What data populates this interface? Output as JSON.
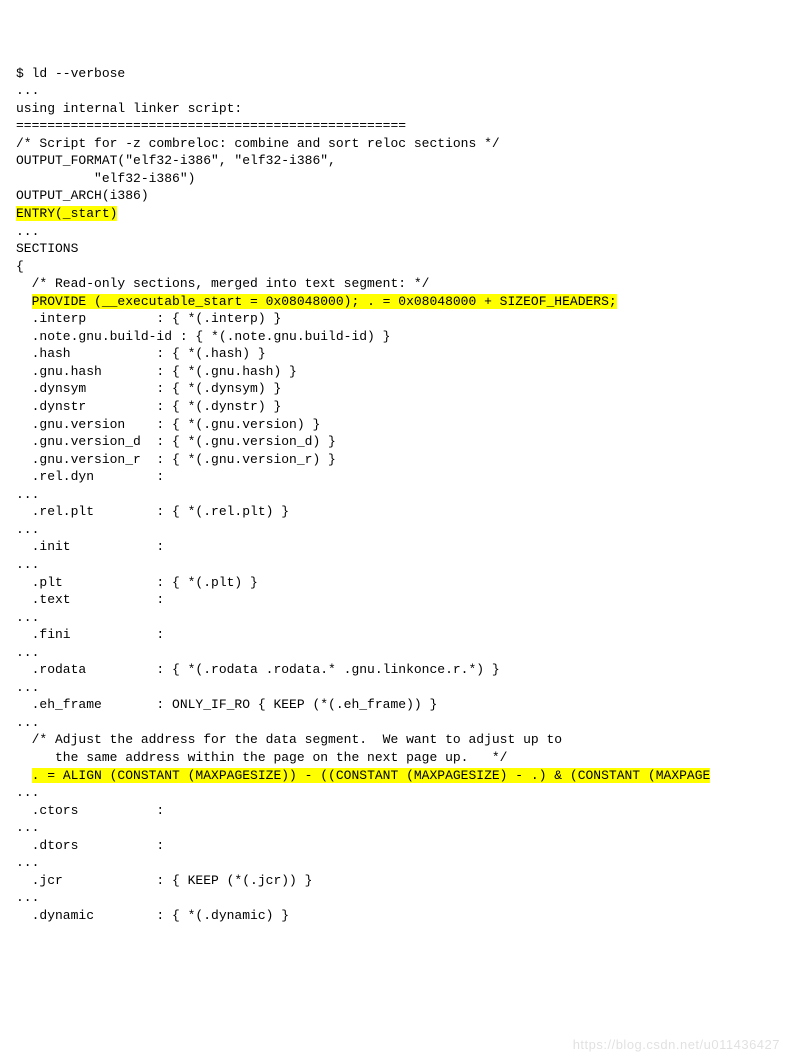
{
  "lines": {
    "l01": "$ ld --verbose",
    "l02": "...",
    "l03": "using internal linker script:",
    "l04": "==================================================",
    "l05": "/* Script for -z combreloc: combine and sort reloc sections */",
    "l06": "OUTPUT_FORMAT(\"elf32-i386\", \"elf32-i386\",",
    "l07": "          \"elf32-i386\")",
    "l08": "OUTPUT_ARCH(i386)",
    "l09": "ENTRY(_start)",
    "l10": "...",
    "l11": "SECTIONS",
    "l12": "{",
    "l13": "  /* Read-only sections, merged into text segment: */",
    "l14": "  PROVIDE (__executable_start = 0x08048000); . = 0x08048000 + SIZEOF_HEADERS;",
    "l15": "  .interp         : { *(.interp) }",
    "l16": "  .note.gnu.build-id : { *(.note.gnu.build-id) }",
    "l17": "  .hash           : { *(.hash) }",
    "l18": "  .gnu.hash       : { *(.gnu.hash) }",
    "l19": "  .dynsym         : { *(.dynsym) }",
    "l20": "  .dynstr         : { *(.dynstr) }",
    "l21": "  .gnu.version    : { *(.gnu.version) }",
    "l22": "  .gnu.version_d  : { *(.gnu.version_d) }",
    "l23": "  .gnu.version_r  : { *(.gnu.version_r) }",
    "l24": "  .rel.dyn        :",
    "l25": "...",
    "l26": "  .rel.plt        : { *(.rel.plt) }",
    "l27": "...",
    "l28": "  .init           :",
    "l29": "...",
    "l30": "  .plt            : { *(.plt) }",
    "l31": "  .text           :",
    "l32": "...",
    "l33": "  .fini           :",
    "l34": "...",
    "l35": "  .rodata         : { *(.rodata .rodata.* .gnu.linkonce.r.*) }",
    "l36": "...",
    "l37": "  .eh_frame       : ONLY_IF_RO { KEEP (*(.eh_frame)) }",
    "l38": "...",
    "l39": "  /* Adjust the address for the data segment.  We want to adjust up to",
    "l40": "     the same address within the page on the next page up.   */",
    "l41": "  . = ALIGN (CONSTANT (MAXPAGESIZE)) - ((CONSTANT (MAXPAGESIZE) - .) & (CONSTANT (MAXPAGE",
    "l42": "...",
    "l43": "  .ctors          :",
    "l44": "...",
    "l45": "  .dtors          :",
    "l46": "...",
    "l47": "  .jcr            : { KEEP (*(.jcr)) }",
    "l48": "...",
    "l49": "  .dynamic        : { *(.dynamic) }"
  },
  "watermark": "https://blog.csdn.net/u011436427"
}
